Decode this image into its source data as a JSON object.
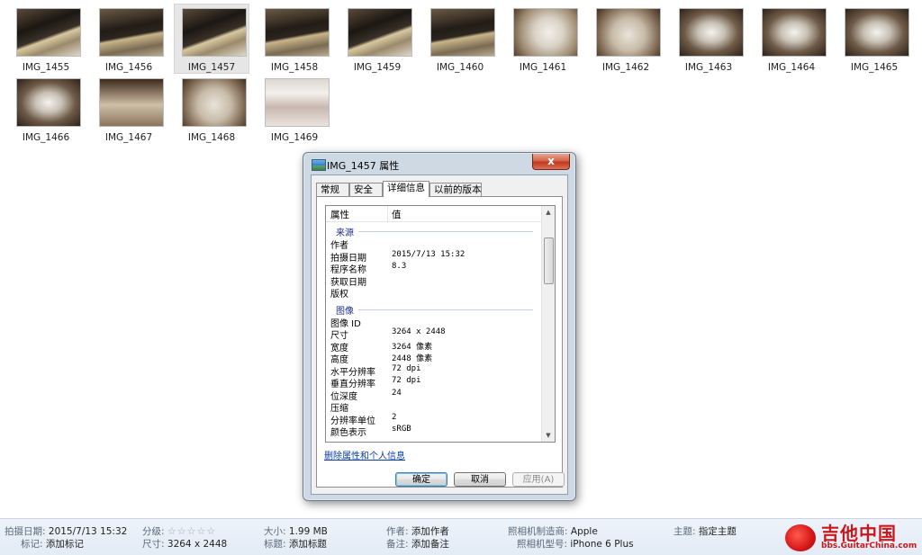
{
  "files": [
    {
      "name": "IMG_1455",
      "thumb": "laptop-photo"
    },
    {
      "name": "IMG_1456",
      "thumb": "laptop-photo"
    },
    {
      "name": "IMG_1457",
      "thumb": "laptop-photo",
      "selected": true
    },
    {
      "name": "IMG_1458",
      "thumb": "laptop-photo"
    },
    {
      "name": "IMG_1459",
      "thumb": "laptop-photo"
    },
    {
      "name": "IMG_1460",
      "thumb": "laptop-photo"
    },
    {
      "name": "IMG_1461",
      "thumb": "box-photo"
    },
    {
      "name": "IMG_1462",
      "thumb": "box-photo"
    },
    {
      "name": "IMG_1463",
      "thumb": "wrap-photo"
    },
    {
      "name": "IMG_1464",
      "thumb": "wrap-photo"
    },
    {
      "name": "IMG_1465",
      "thumb": "wrap-photo"
    },
    {
      "name": "IMG_1466",
      "thumb": "wrap-photo"
    },
    {
      "name": "IMG_1467",
      "thumb": "package-photo"
    },
    {
      "name": "IMG_1468",
      "thumb": "box-photo"
    },
    {
      "name": "IMG_1469",
      "thumb": "label-photo"
    }
  ],
  "dialog": {
    "title": "IMG_1457 属性",
    "close_label": "x",
    "tabs": [
      {
        "label": "常规"
      },
      {
        "label": "安全"
      },
      {
        "label": "详细信息",
        "active": true
      },
      {
        "label": "以前的版本"
      }
    ],
    "columns": {
      "property": "属性",
      "value": "值"
    },
    "groups": [
      {
        "label": "来源",
        "rows": [
          {
            "k": "作者",
            "v": ""
          },
          {
            "k": "拍摄日期",
            "v": "2015/7/13 15:32"
          },
          {
            "k": "程序名称",
            "v": "8.3"
          },
          {
            "k": "获取日期",
            "v": ""
          },
          {
            "k": "版权",
            "v": ""
          }
        ]
      },
      {
        "label": "图像",
        "rows": [
          {
            "k": "图像 ID",
            "v": ""
          },
          {
            "k": "尺寸",
            "v": "3264 x 2448"
          },
          {
            "k": "宽度",
            "v": "3264 像素"
          },
          {
            "k": "高度",
            "v": "2448 像素"
          },
          {
            "k": "水平分辨率",
            "v": "72 dpi"
          },
          {
            "k": "垂直分辨率",
            "v": "72 dpi"
          },
          {
            "k": "位深度",
            "v": "24"
          },
          {
            "k": "压缩",
            "v": ""
          },
          {
            "k": "分辨率单位",
            "v": "2"
          },
          {
            "k": "颜色表示",
            "v": "sRGB"
          }
        ]
      }
    ],
    "remove_link": "删除属性和个人信息",
    "buttons": {
      "ok": "确定",
      "cancel": "取消",
      "apply": "应用(A)"
    }
  },
  "details": {
    "date_label": "拍摄日期:",
    "date_value": "2015/7/13 15:32",
    "tags_label": "标记:",
    "tags_value": "添加标记",
    "rating_label": "分级:",
    "rating_stars": 0,
    "dims_label": "尺寸:",
    "dims_value": "3264 x 2448",
    "size_label": "大小:",
    "size_value": "1.99 MB",
    "title_label": "标题:",
    "title_value": "添加标题",
    "author_label": "作者:",
    "author_value": "添加作者",
    "comment_label": "备注:",
    "comment_value": "添加备注",
    "maker_label": "照相机制造商:",
    "maker_value": "Apple",
    "model_label": "照相机型号:",
    "model_value": "iPhone 6 Plus",
    "subject_label": "主题:",
    "subject_value": "指定主题"
  },
  "logo": {
    "name": "吉他中国",
    "url": "bbs.GuitarChina.com"
  }
}
